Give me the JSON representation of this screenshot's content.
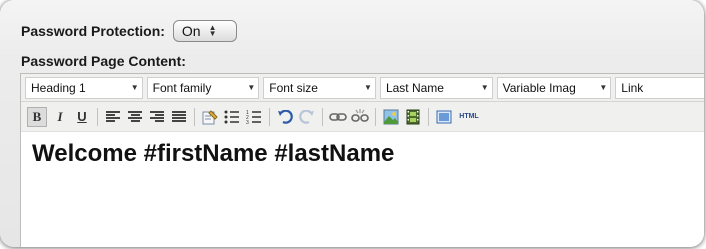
{
  "protection": {
    "label": "Password Protection:",
    "value": "On"
  },
  "content_label": "Password Page Content:",
  "toolbar_dropdowns": {
    "heading": "Heading 1",
    "font_family": "Font family",
    "font_size": "Font size",
    "last_name": "Last Name",
    "variable_image": "Variable Imag",
    "link": "Link"
  },
  "toolbar_buttons": {
    "bold": "B",
    "italic": "I",
    "underline": "U",
    "html": "HTML"
  },
  "editor_content": "Welcome #firstName #lastName"
}
